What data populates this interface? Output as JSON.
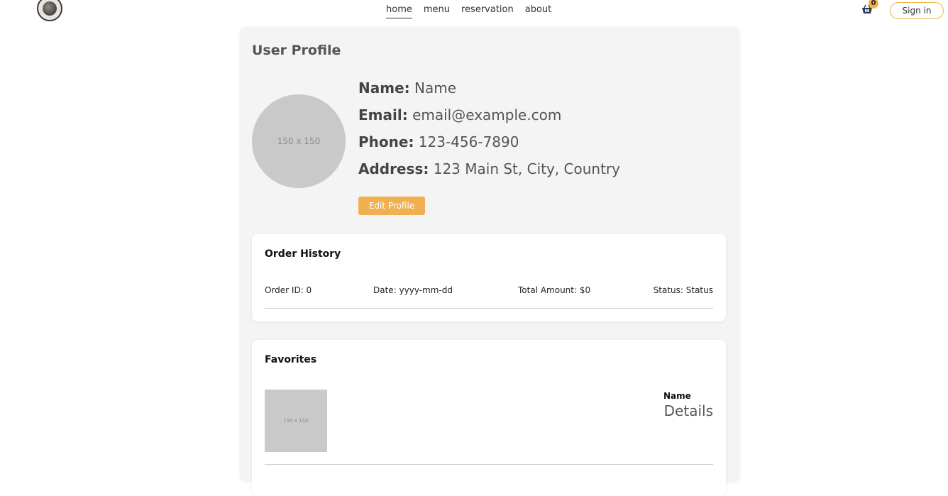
{
  "nav": {
    "items": [
      "home",
      "menu",
      "reservation",
      "about"
    ],
    "active": "home"
  },
  "cart": {
    "count": "0"
  },
  "signin_label": "Sign in",
  "profile": {
    "title": "User Profile",
    "avatar_placeholder": "150 x 150",
    "name_label": "Name:",
    "name_value": "Name",
    "email_label": "Email:",
    "email_value": "email@example.com",
    "phone_label": "Phone:",
    "phone_value": "123-456-7890",
    "address_label": "Address:",
    "address_value": "123 Main St, City, Country",
    "edit_label": "Edit Profile"
  },
  "orders": {
    "title": "Order History",
    "rows": [
      {
        "id": "Order ID: 0",
        "date": "Date: yyyy-mm-dd",
        "total": "Total Amount: $0",
        "status": "Status: Status"
      }
    ]
  },
  "favorites": {
    "title": "Favorites",
    "items": [
      {
        "image_placeholder": "150 x 150",
        "name": "Name",
        "details": "Details"
      }
    ]
  },
  "colors": {
    "accent": "#f0b050",
    "card_bg": "#f4f4f4",
    "placeholder_bg": "#c9c9c9"
  }
}
